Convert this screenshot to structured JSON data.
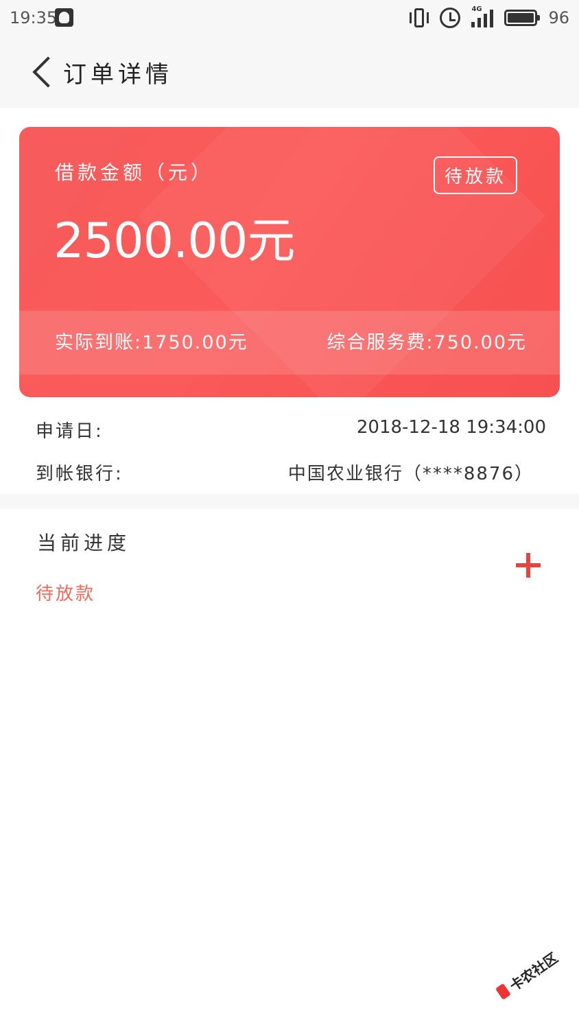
{
  "status_bar": {
    "time": "19:35",
    "signal_label": "4G",
    "battery": "96"
  },
  "nav": {
    "title": "订单详情"
  },
  "card": {
    "amount_label": "借款金额（元）",
    "amount": "2500.00元",
    "status_tag": "待放款",
    "actual_received": "实际到账:1750.00元",
    "service_fee": "综合服务费:750.00元"
  },
  "details": {
    "apply_date_label": "申请日:",
    "apply_date_value": "2018-12-18 19:34:00",
    "bank_label": "到帐银行:",
    "bank_value": "中国农业银行（****8876）"
  },
  "progress": {
    "title": "当前进度",
    "status": "待放款"
  },
  "watermark": {
    "text": "卡农社区"
  },
  "colors": {
    "accent": "#f75555",
    "status_text": "#f06a5a",
    "plus": "#e8443f"
  }
}
